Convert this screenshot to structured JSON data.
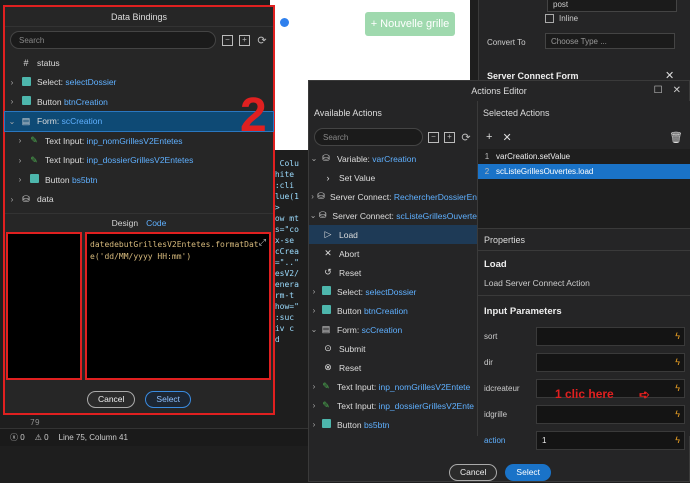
{
  "background": {
    "green_button": "+ Nouvelle grille",
    "right_panel": {
      "field_value": "post",
      "inline_label": "Inline",
      "convert_to_label": "Convert To",
      "convert_to_placeholder": "Choose Type ...",
      "section_title": "Server Connect Form"
    },
    "code_lines": [
      "< Colu",
      "white",
      "n:cli",
      "alue(1",
      "n>",
      "",
      "row mt",
      "ss=\"co",
      "",
      "mx-se",
      "scCrea",
      "n=\"..\"",
      "lesV2/",
      "genera",
      "orm-t",
      "show=\"",
      "n:suc",
      "div c",
      "  <d"
    ],
    "line_number": "79",
    "status": {
      "errors": "0",
      "warnings": "0",
      "position": "Line 75, Column 41"
    }
  },
  "data_bindings": {
    "title": "Data Bindings",
    "search_placeholder": "Search",
    "tree": [
      {
        "icon": "#",
        "label": "status",
        "value": ""
      },
      {
        "label": "Select:",
        "value": "selectDossier"
      },
      {
        "label": "Button",
        "value": "btnCreation"
      },
      {
        "label": "Form:",
        "value": "scCreation"
      },
      {
        "label": "Text Input:",
        "value": "inp_nomGrillesV2Entetes"
      },
      {
        "label": "Text Input:",
        "value": "inp_dossierGrillesV2Entetes"
      },
      {
        "label": "Button",
        "value": "bs5btn"
      },
      {
        "label": "data",
        "value": ""
      }
    ],
    "tab_design": "Design",
    "tab_code": "Code",
    "code_line1": "datedebutGrillesV2Entetes.formatDat",
    "code_line2": "e('dd/MM/yyyy HH:mm')",
    "cancel": "Cancel",
    "select": "Select",
    "annotation": "2"
  },
  "actions_editor": {
    "title": "Actions Editor",
    "available_header": "Available Actions",
    "search_placeholder": "Search",
    "actions": [
      {
        "label": "Variable:",
        "value": "varCreation"
      },
      {
        "label": "Set Value",
        "value": ""
      },
      {
        "label": "Server Connect:",
        "value": "RechercherDossierEn"
      },
      {
        "label": "Server Connect:",
        "value": "scListeGrillesOuverte"
      },
      {
        "label": "Load",
        "value": ""
      },
      {
        "label": "Abort",
        "value": ""
      },
      {
        "label": "Reset",
        "value": ""
      },
      {
        "label": "Select:",
        "value": "selectDossier"
      },
      {
        "label": "Button",
        "value": "btnCreation"
      },
      {
        "label": "Form:",
        "value": "scCreation"
      },
      {
        "label": "Submit",
        "value": ""
      },
      {
        "label": "Reset",
        "value": ""
      },
      {
        "label": "Text Input:",
        "value": "inp_nomGrillesV2Entete"
      },
      {
        "label": "Text Input:",
        "value": "inp_dossierGrillesV2Ente"
      },
      {
        "label": "Button",
        "value": "bs5btn"
      }
    ],
    "selected_header": "Selected Actions",
    "selected": [
      {
        "num": "1",
        "label": "varCreation.setValue"
      },
      {
        "num": "2",
        "label": "scListeGrillesOuvertes.load"
      }
    ],
    "properties_header": "Properties",
    "prop_title": "Load",
    "prop_desc": "Load Server Connect Action",
    "input_params_header": "Input Parameters",
    "params": [
      {
        "name": "sort",
        "value": ""
      },
      {
        "name": "dir",
        "value": ""
      },
      {
        "name": "idcreateur",
        "value": ""
      },
      {
        "name": "idgrille",
        "value": ""
      },
      {
        "name": "action",
        "value": "1"
      }
    ],
    "cancel": "Cancel",
    "select": "Select",
    "annotation": "1 clic here"
  }
}
